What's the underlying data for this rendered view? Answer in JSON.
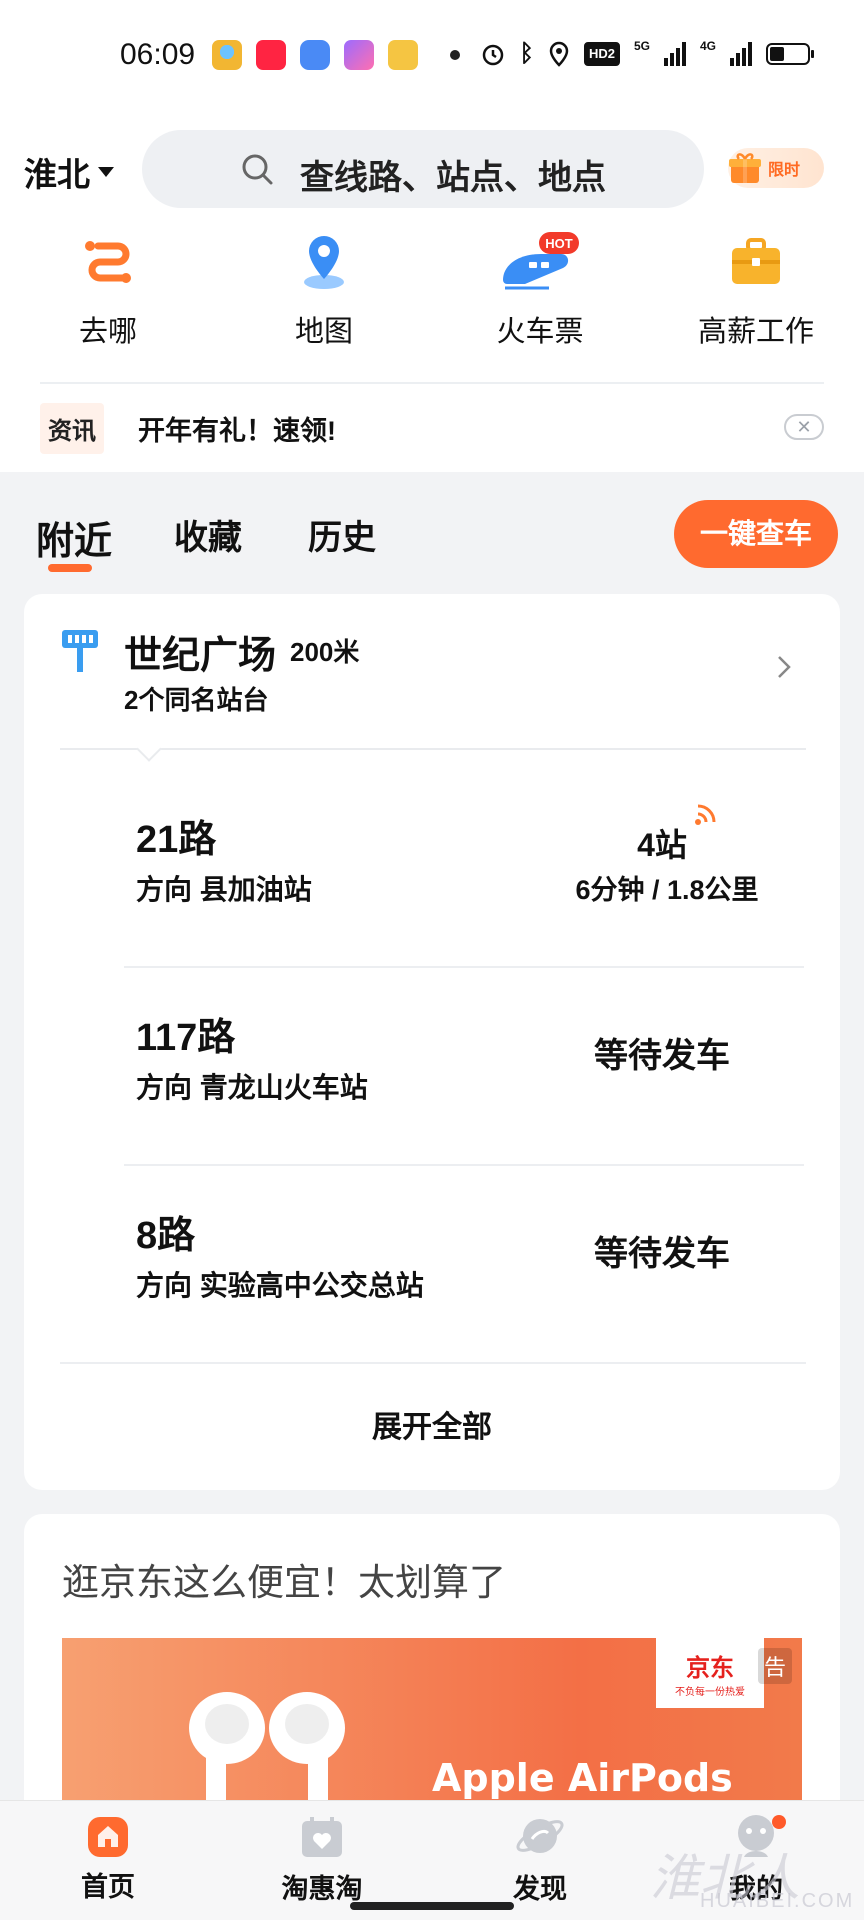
{
  "status_bar": {
    "time": "06:09",
    "net_5g": "5G",
    "net_4g": "4G",
    "hd_label": "HD2",
    "app_icons": [
      "bird-app-icon",
      "xiaohongshu-icon",
      "message-icon",
      "ai-icon",
      "coupon-icon"
    ]
  },
  "header": {
    "city": "淮北",
    "search_placeholder": "查线路、站点、地点",
    "promo_label": "限时"
  },
  "quick_actions": [
    {
      "label": "去哪",
      "icon": "route-icon"
    },
    {
      "label": "地图",
      "icon": "map-pin-icon"
    },
    {
      "label": "火车票",
      "icon": "train-icon",
      "badge": "HOT"
    },
    {
      "label": "高薪工作",
      "icon": "briefcase-icon"
    }
  ],
  "news": {
    "tag": "资讯",
    "text": "开年有礼！速领!",
    "close": "✕"
  },
  "tabs": {
    "nearby": "附近",
    "favorites": "收藏",
    "history": "历史",
    "check_bus": "一键查车"
  },
  "station": {
    "name": "世纪广场",
    "distance": "200米",
    "subtitle": "2个同名站台"
  },
  "routes": [
    {
      "name": "21路",
      "direction": "方向 县加油站",
      "stops": "4站",
      "eta": "6分钟 / 1.8公里"
    },
    {
      "name": "117路",
      "direction": "方向 青龙山火车站",
      "status": "等待发车"
    },
    {
      "name": "8路",
      "direction": "方向 实验高中公交总站",
      "status": "等待发车"
    }
  ],
  "expand_all": "展开全部",
  "ad": {
    "title": "逛京东这么便宜！太划算了",
    "brand": "京东",
    "brand_sub": "不负每一份热爱",
    "tag": "告",
    "product": "Apple AirPods"
  },
  "bottom_nav": [
    {
      "label": "首页",
      "icon": "home-icon",
      "active": true
    },
    {
      "label": "淘惠淘",
      "icon": "coupon-bag-icon"
    },
    {
      "label": "发现",
      "icon": "planet-icon"
    },
    {
      "label": "我的",
      "icon": "profile-icon"
    }
  ],
  "watermark": {
    "text": "淮北人",
    "sub": "HUAIBEI.COM"
  },
  "colors": {
    "accent": "#ff6a2f",
    "background": "#f2f3f5",
    "card": "#ffffff",
    "station_icon": "#3a9df0"
  }
}
